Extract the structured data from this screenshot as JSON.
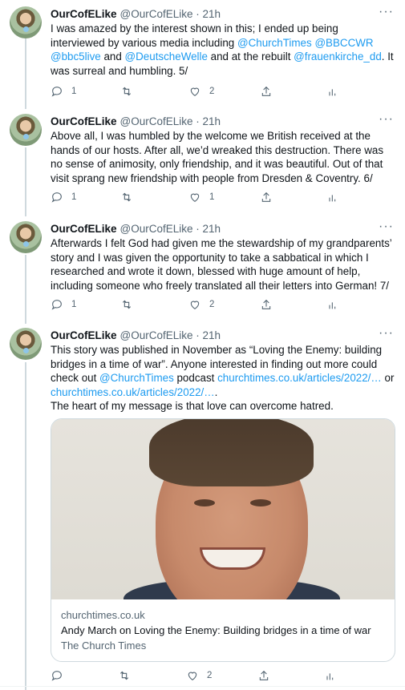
{
  "tweets": [
    {
      "name": "OurCofELike",
      "handle": "@OurCofELike · 21h",
      "text_parts": [
        {
          "t": "I was amazed by the interest shown in this; I ended up being interviewed by various media including "
        },
        {
          "t": "@ChurchTimes",
          "link": true
        },
        {
          "t": " "
        },
        {
          "t": "@BBCCWR",
          "link": true
        },
        {
          "t": " "
        },
        {
          "t": "@bbc5live",
          "link": true
        },
        {
          "t": " and "
        },
        {
          "t": "@DeutscheWelle",
          "link": true
        },
        {
          "t": " and at the rebuilt "
        },
        {
          "t": "@frauenkirche_dd",
          "link": true
        },
        {
          "t": ". It was surreal and humbling. 5/"
        }
      ],
      "replies": "1",
      "retweets": "",
      "likes": "2"
    },
    {
      "name": "OurCofELike",
      "handle": "@OurCofELike · 21h",
      "text_parts": [
        {
          "t": "Above all, I was humbled by the welcome we British received at the hands of our hosts. After all, we’d wreaked this destruction. There was no sense of animosity, only friendship, and it was beautiful. Out of that visit sprang new friendship with people from Dresden & Coventry. 6/"
        }
      ],
      "replies": "1",
      "retweets": "",
      "likes": "1"
    },
    {
      "name": "OurCofELike",
      "handle": "@OurCofELike · 21h",
      "text_parts": [
        {
          "t": "Afterwards I felt God had given me the stewardship of my grandparents’ story and I was given the opportunity to take a sabbatical in which I researched and wrote it down, blessed with huge amount of help, including someone who freely translated all their letters into German! 7/"
        }
      ],
      "replies": "1",
      "retweets": "",
      "likes": "2"
    },
    {
      "name": "OurCofELike",
      "handle": "@OurCofELike · 21h",
      "text_parts": [
        {
          "t": "This story was published in November as “Loving the Enemy: building bridges in a time of war”. Anyone interested in finding out more could check out "
        },
        {
          "t": "@ChurchTimes",
          "link": true
        },
        {
          "t": " podcast "
        },
        {
          "t": "churchtimes.co.uk/articles/2022/…",
          "link": true
        },
        {
          "t": " or "
        },
        {
          "t": "churchtimes.co.uk/articles/2022/…",
          "link": true
        },
        {
          "t": ".\nThe heart of my message is that love can overcome hatred."
        }
      ],
      "replies": "",
      "retweets": "",
      "likes": "2"
    }
  ],
  "card": {
    "domain": "churchtimes.co.uk",
    "title": "Andy March on Loving the Enemy: Building bridges in a time of war",
    "site": "The Church Times"
  },
  "ui": {
    "more_glyph": "···",
    "icons": [
      "reply-icon",
      "retweet-icon",
      "like-icon",
      "share-icon",
      "analytics-icon",
      "more-icon"
    ],
    "link_color": "#1d9bf0",
    "muted_color": "#536471"
  }
}
